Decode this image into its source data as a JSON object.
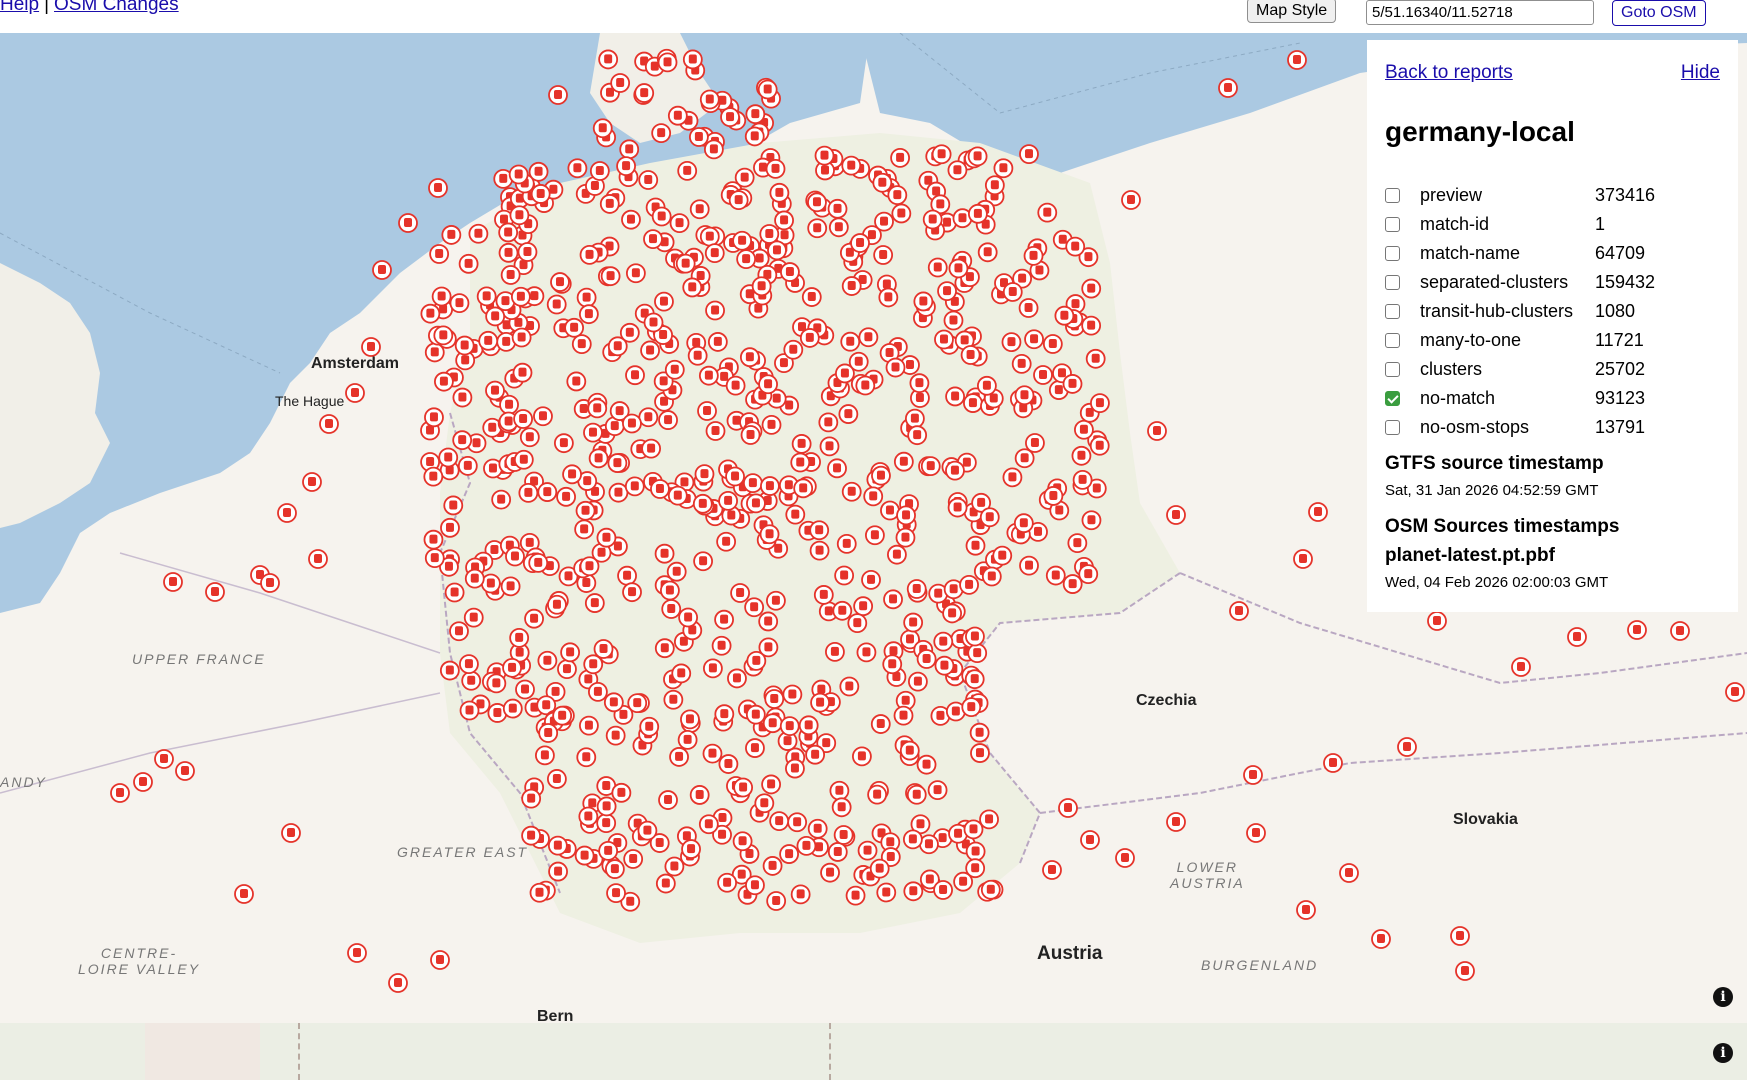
{
  "topbar": {
    "help_link": "Help",
    "separator": "|",
    "osm_changes_link": "OSM Changes",
    "map_style_button": "Map Style",
    "coord_value": "5/51.16340/11.52718",
    "goto_button": "Goto OSM"
  },
  "panel": {
    "back_link": "Back to reports",
    "hide_link": "Hide",
    "title": "germany-local",
    "reports": [
      {
        "name": "preview",
        "count": "373416",
        "checked": false
      },
      {
        "name": "match-id",
        "count": "1",
        "checked": false
      },
      {
        "name": "match-name",
        "count": "64709",
        "checked": false
      },
      {
        "name": "separated-clusters",
        "count": "159432",
        "checked": false
      },
      {
        "name": "transit-hub-clusters",
        "count": "1080",
        "checked": false
      },
      {
        "name": "many-to-one",
        "count": "11721",
        "checked": false
      },
      {
        "name": "clusters",
        "count": "25702",
        "checked": false
      },
      {
        "name": "no-match",
        "count": "93123",
        "checked": true
      },
      {
        "name": "no-osm-stops",
        "count": "13791",
        "checked": false
      }
    ],
    "gtfs_heading": "GTFS source timestamp",
    "gtfs_timestamp": "Sat, 31 Jan 2026 04:52:59 GMT",
    "osm_heading": "OSM Sources timestamps",
    "osm_file": "planet-latest.pt.pbf",
    "osm_timestamp": "Wed, 04 Feb 2026 02:00:03 GMT"
  },
  "map": {
    "places": {
      "amsterdam": "Amsterdam",
      "the_hague": "The Hague",
      "czechia": "Czechia",
      "slovakia": "Slovakia",
      "austria": "Austria",
      "bern": "Bern"
    },
    "regions": {
      "upper_france": "UPPER FRANCE",
      "greater_east": "GREATER EAST",
      "centre_loire": "CENTRE-\nLOIRE VALLEY",
      "lower_austria": "LOWER\nAUSTRIA",
      "burgenland": "BURGENLAND",
      "normandy_fragment": "ANDY"
    },
    "info_icon": "i",
    "colors": {
      "sea": "#abc9e2",
      "land": "#f6f3ee",
      "marker": "#e5332a"
    }
  }
}
